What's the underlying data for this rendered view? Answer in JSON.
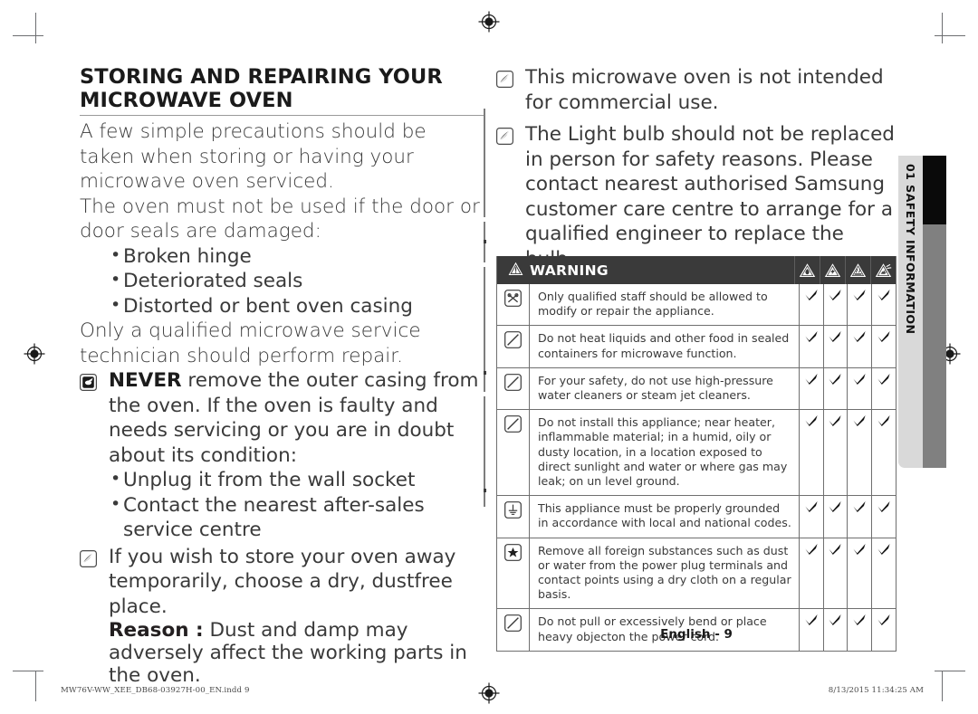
{
  "document": {
    "section_tab": "01 SAFETY INFORMATION",
    "page_label": "English - 9",
    "imprint_file": "MW76V-WW_XEE_DB68-03927H-00_EN.indd   9",
    "imprint_timestamp": "8/13/2015   11:34:25 AM"
  },
  "left_column": {
    "title": "STORING AND REPAIRING YOUR MICROWAVE OVEN",
    "intro_1": "A few simple precautions should be taken when storing or having your microwave oven serviced.",
    "intro_2": "The oven must not be used if the door or door seals are damaged:",
    "damage_list": [
      "Broken hinge",
      "Deteriorated seals",
      "Distorted or bent oven casing"
    ],
    "repair_note": "Only a qualified microwave service technician should perform repair.",
    "never_strong": "NEVER",
    "never_text": " remove the outer casing from the oven. If the oven is faulty and needs servicing or you are in doubt about its condition:",
    "action_list": [
      "Unplug it from the wall socket",
      "Contact the nearest after-sales service centre"
    ],
    "store_note": "If you wish to store your oven away temporarily, choose a dry, dustfree place.",
    "reason_label": "Reason :",
    "reason_text": " Dust and damp may adversely affect the working parts in the oven."
  },
  "right_column": {
    "note_1": "This microwave oven is not intended for commercial use.",
    "note_2": "The Light bulb should not be replaced in person for safety reasons. Please contact nearest authorised Samsung customer care centre to arrange for a qualified engineer to replace the bulb."
  },
  "warning_table": {
    "header_label": "WARNING",
    "header_icons": [
      "hazard-fire-icon",
      "hazard-electric-shock-icon",
      "hazard-hot-surface-icon",
      "hazard-explosion-icon"
    ],
    "check_mark": "✔",
    "rows": [
      {
        "icon": "no-disassembly-icon",
        "text": "Only qualified staff should be allowed to modify or repair the appliance.",
        "checks": [
          true,
          true,
          true,
          true
        ]
      },
      {
        "icon": "prohibited-icon",
        "text": "Do not heat liquids and other food in sealed containers for microwave function.",
        "checks": [
          true,
          true,
          true,
          true
        ]
      },
      {
        "icon": "prohibited-icon",
        "text": "For your safety, do not use high-pressure water cleaners or steam jet cleaners.",
        "checks": [
          true,
          true,
          true,
          true
        ]
      },
      {
        "icon": "prohibited-icon",
        "text": "Do not install this appliance; near heater, inflammable material; in a humid, oily or dusty location, in a location exposed to direct sunlight and water or where gas may leak; on un level ground.",
        "checks": [
          true,
          true,
          true,
          true
        ]
      },
      {
        "icon": "grounding-icon",
        "text": "This appliance must be properly grounded in accordance with local and national codes.",
        "checks": [
          true,
          true,
          true,
          true
        ]
      },
      {
        "icon": "mandatory-star-icon",
        "text": "Remove all foreign substances such as dust or water from the power plug terminals and contact points using a dry cloth on a regular basis.",
        "checks": [
          true,
          true,
          true,
          true
        ]
      },
      {
        "icon": "prohibited-icon",
        "text": "Do not pull or excessively bend or place heavy objecton the power cord.",
        "checks": [
          true,
          true,
          true,
          true
        ]
      }
    ]
  },
  "colors": {
    "header_bar": "#3a3a3a",
    "tab_gray": "#808080",
    "tab_black": "#0a0a0a",
    "tab_light": "#d9d9d9",
    "body_text": "#3a3a3a"
  }
}
